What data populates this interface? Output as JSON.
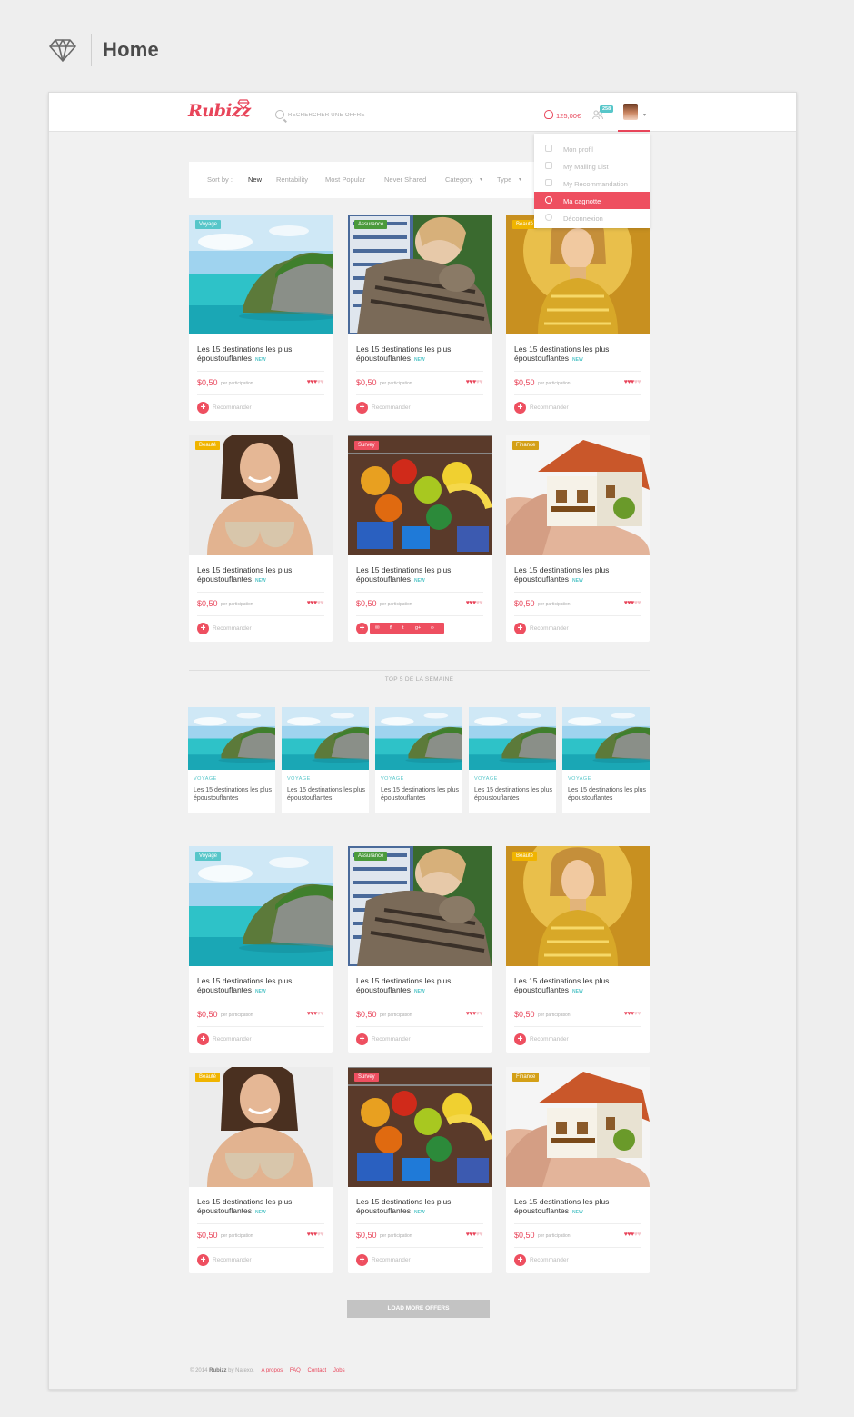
{
  "page": {
    "title": "Home"
  },
  "app": {
    "logo_text": "Rubizz"
  },
  "header": {
    "search_placeholder": "RECHERCHER UNE OFFRE",
    "balance": "125,00€",
    "notifications_count": "258"
  },
  "dropdown": {
    "items": [
      {
        "label": "Mon profil",
        "icon": "user-icon",
        "active": false
      },
      {
        "label": "My Mailing List",
        "icon": "group-icon",
        "active": false
      },
      {
        "label": "My Recommandation",
        "icon": "thumb-icon",
        "active": false
      },
      {
        "label": "Ma cagnotte",
        "icon": "piggy-bank-icon",
        "active": true
      },
      {
        "label": "Déconnexion",
        "icon": "power-icon",
        "active": false
      }
    ]
  },
  "sort": {
    "label": "Sort by :",
    "options": [
      "New",
      "Rentability",
      "Most Popular",
      "Never Shared",
      "Category",
      "Type"
    ],
    "active": "New"
  },
  "card_common": {
    "title": "Les 15 destinations les plus époustouflantes",
    "new_badge": "NEW",
    "price": "$0,50",
    "per": "per participation",
    "recommend": "Recommander",
    "rating": 3
  },
  "cards": [
    {
      "tag": "Voyage",
      "tag_color": "#57c6c9",
      "image": "island"
    },
    {
      "tag": "Assurance",
      "tag_color": "#4a9a3c",
      "image": "cat-child"
    },
    {
      "tag": "Beauté",
      "tag_color": "#f0b400",
      "image": "woman-gold"
    },
    {
      "tag": "Beauté",
      "tag_color": "#f0b400",
      "image": "woman-bra"
    },
    {
      "tag": "Survey",
      "tag_color": "#ee4f60",
      "image": "groceries"
    },
    {
      "tag": "Finance",
      "tag_color": "#d4a017",
      "image": "house-hand"
    },
    {
      "tag": "Voyage",
      "tag_color": "#57c6c9",
      "image": "island"
    },
    {
      "tag": "Assurance",
      "tag_color": "#4a9a3c",
      "image": "cat-child"
    },
    {
      "tag": "Beauté",
      "tag_color": "#f0b400",
      "image": "woman-gold"
    },
    {
      "tag": "Beauté",
      "tag_color": "#f0b400",
      "image": "woman-bra"
    },
    {
      "tag": "Survey",
      "tag_color": "#ee4f60",
      "image": "groceries"
    },
    {
      "tag": "Finance",
      "tag_color": "#d4a017",
      "image": "house-hand"
    }
  ],
  "share_bar": {
    "icons": [
      "mail-icon",
      "facebook-icon",
      "twitter-icon",
      "google-plus-icon",
      "link-icon"
    ]
  },
  "top5": {
    "title": "TOP 5 DE LA SEMAINE",
    "items": [
      {
        "category": "VOYAGE",
        "title": "Les 15 destinations les plus époustouflantes"
      },
      {
        "category": "VOYAGE",
        "title": "Les 15 destinations les plus époustouflantes"
      },
      {
        "category": "VOYAGE",
        "title": "Les 15 destinations les plus époustouflantes"
      },
      {
        "category": "VOYAGE",
        "title": "Les 15 destinations les plus époustouflantes"
      },
      {
        "category": "VOYAGE",
        "title": "Les 15 destinations les plus époustouflantes"
      }
    ]
  },
  "load_more": "LOAD MORE OFFERS",
  "footer": {
    "copyright": "© 2014",
    "brand": "Rubizz",
    "by": "by Natexo.",
    "links": [
      "A propos",
      "FAQ",
      "Contact",
      "Jobs"
    ]
  },
  "colors": {
    "accent": "#e8455a",
    "teal": "#57c6c9"
  }
}
